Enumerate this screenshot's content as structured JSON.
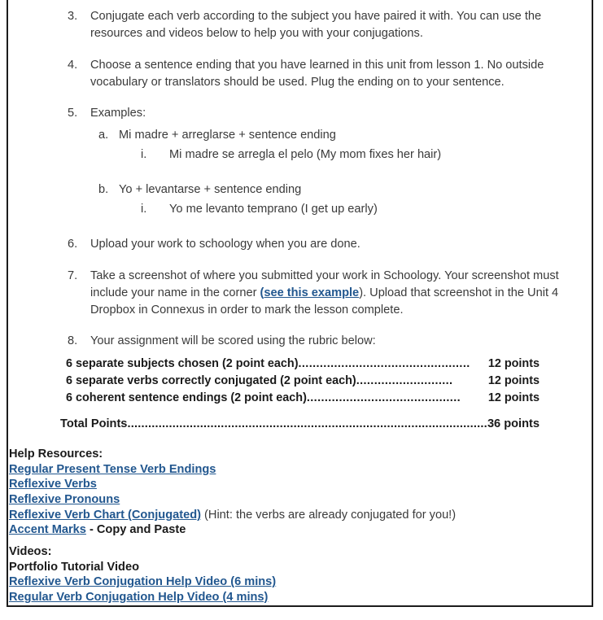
{
  "document": {
    "instructions": [
      {
        "number": "3.",
        "text": "Conjugate each verb according to the subject you have paired it with. You can use the resources and videos below to help you with your conjugations."
      },
      {
        "number": "4.",
        "text": "Choose a sentence ending that you have learned in this unit from lesson 1. No outside vocabulary or translators should be used. Plug the ending on to your sentence."
      },
      {
        "number": "5.",
        "text": "Examples:"
      },
      {
        "number": "6.",
        "text": "Upload your work to schoology when you are done."
      },
      {
        "number": "7.",
        "text_before_link": "Take a screenshot of where you submitted your work in Schoology. Your screenshot must include your name in the corner ",
        "link_open_paren": "(",
        "link_text": "see this example",
        "text_after_link": "). Upload that screenshot in the Unit 4 Dropbox in Connexus in order to mark the lesson complete."
      },
      {
        "number": "8.",
        "text": "Your assignment will be scored using the rubric below:"
      }
    ],
    "examples": [
      {
        "marker": "a.",
        "text": "Mi madre + arreglarse + sentence ending",
        "sub_marker": "i.",
        "sub_text": "Mi madre se arregla el pelo (My mom fixes her hair)"
      },
      {
        "marker": "b.",
        "text": "Yo + levantarse + sentence ending",
        "sub_marker": "i.",
        "sub_text": "Yo me levanto tempranо (I get up early)"
      }
    ],
    "rubric": {
      "rows": [
        {
          "label": "6 separate subjects chosen (2 point each)",
          "dots": "................................................",
          "value": "12 points"
        },
        {
          "label": "6 separate verbs correctly conjugated (2 point each)",
          "dots": "...........................",
          "value": "12 points"
        },
        {
          "label": "6 coherent sentence endings (2 point each)",
          "dots": "...........................................",
          "value": "12 points"
        }
      ],
      "total": {
        "label": "Total Points",
        "dots": "...........................................................................................................",
        "value": "36 points"
      }
    },
    "help_resources": {
      "heading": "Help Resources:",
      "links": [
        {
          "label": "Regular Present Tense Verb Endings",
          "suffix": ""
        },
        {
          "label": "Reflexive Verbs",
          "suffix": ""
        },
        {
          "label": "Reflexive Pronouns",
          "suffix": ""
        },
        {
          "label": "Reflexive Verb Chart (Conjugated)",
          "suffix": " (Hint: the verbs are already conjugated for you!)"
        },
        {
          "label": "Accent Marks",
          "suffix": " - Copy and Paste"
        }
      ]
    },
    "videos": {
      "heading": "Videos:",
      "plain_item": "Portfolio Tutorial Video",
      "links": [
        "Reflexive Verb Conjugation Help Video (6 mins)",
        "Regular Verb Conjugation Help Video (4 mins)"
      ]
    },
    "colors": {
      "link": "#22578f",
      "body_text": "#3a3a3a",
      "heading_text": "#1a1a1a",
      "border": "#1c1c1c"
    }
  }
}
